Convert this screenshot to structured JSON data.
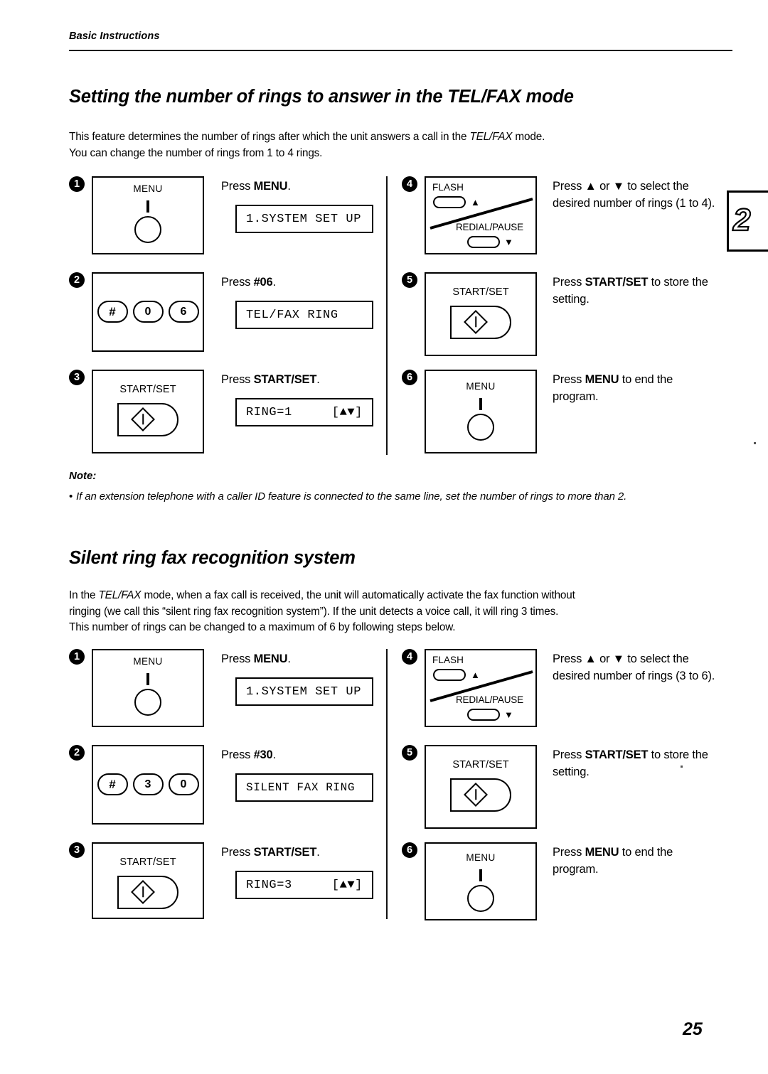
{
  "header": {
    "running_head": "Basic Instructions"
  },
  "page_number": "25",
  "chapter_tab": "2",
  "sections": [
    {
      "title": "Setting the number of rings to answer in the TEL/FAX mode",
      "intro_line1_pre": "This feature determines the number of rings after which the unit answers a call in the ",
      "intro_line1_italic": "TEL/FAX",
      "intro_line1_post": " mode.",
      "intro_line2": "You can change the number of rings from 1 to 4 rings.",
      "steps": [
        {
          "num": "1",
          "panel": "menu-key",
          "panel_label": "MENU",
          "instruction_pre": "Press ",
          "instruction_bold": "MENU",
          "instruction_post": ".",
          "lcd_left": "1.SYSTEM SET UP",
          "lcd_right": ""
        },
        {
          "num": "2",
          "panel": "keypad",
          "keys": [
            "#",
            "0",
            "6"
          ],
          "instruction_pre": "Press ",
          "instruction_bold": "#06",
          "instruction_post": ".",
          "lcd_left": "TEL/FAX RING",
          "lcd_right": ""
        },
        {
          "num": "3",
          "panel": "start-set",
          "panel_label": "START/SET",
          "instruction_pre": "Press ",
          "instruction_bold": "START/SET",
          "instruction_post": ".",
          "lcd_left": "RING=1",
          "lcd_right": "[▲▼]"
        },
        {
          "num": "4",
          "panel": "flash-redial",
          "flash_label": "FLASH",
          "redial_label": "REDIAL/PAUSE",
          "up_arrow": "▲",
          "down_arrow": "▼",
          "instruction_html": "Press ▲ or ▼ to select the desired number of rings (1 to 4).",
          "lcd_left": "",
          "lcd_right": ""
        },
        {
          "num": "5",
          "panel": "start-set",
          "panel_label": "START/SET",
          "instruction_pre": "Press ",
          "instruction_bold": "START/SET",
          "instruction_post": " to store the setting.",
          "lcd_left": "",
          "lcd_right": ""
        },
        {
          "num": "6",
          "panel": "menu-key",
          "panel_label": "MENU",
          "instruction_pre": "Press ",
          "instruction_bold": "MENU",
          "instruction_post": " to end the program.",
          "lcd_left": "",
          "lcd_right": ""
        }
      ],
      "note": {
        "label": "Note:",
        "bullet": "•",
        "text": "If an extension telephone with a caller ID feature is connected to the same line, set the number of rings to more than 2."
      }
    },
    {
      "title": "Silent ring fax recognition system",
      "intro_line1_pre": "In the ",
      "intro_line1_italic": "TEL/FAX",
      "intro_line1_post": " mode, when a fax call is received, the unit will automatically activate the fax function without",
      "intro_line2": "ringing (we call this “silent ring fax recognition system”). If the unit detects a voice call, it will ring 3 times.",
      "intro_line3": "This number of rings can be changed to a maximum of 6 by following steps below.",
      "steps": [
        {
          "num": "1",
          "panel": "menu-key",
          "panel_label": "MENU",
          "instruction_pre": "Press ",
          "instruction_bold": "MENU",
          "instruction_post": ".",
          "lcd_left": "1.SYSTEM SET UP",
          "lcd_right": ""
        },
        {
          "num": "2",
          "panel": "keypad",
          "keys": [
            "#",
            "3",
            "0"
          ],
          "instruction_pre": "Press ",
          "instruction_bold": "#30",
          "instruction_post": ".",
          "lcd_left": "SILENT FAX RING",
          "lcd_right": ""
        },
        {
          "num": "3",
          "panel": "start-set",
          "panel_label": "START/SET",
          "instruction_pre": "Press ",
          "instruction_bold": "START/SET",
          "instruction_post": ".",
          "lcd_left": "RING=3",
          "lcd_right": "[▲▼]"
        },
        {
          "num": "4",
          "panel": "flash-redial",
          "flash_label": "FLASH",
          "redial_label": "REDIAL/PAUSE",
          "up_arrow": "▲",
          "down_arrow": "▼",
          "instruction_html": "Press ▲ or ▼ to select the desired number of rings (3 to 6).",
          "lcd_left": "",
          "lcd_right": ""
        },
        {
          "num": "5",
          "panel": "start-set",
          "panel_label": "START/SET",
          "instruction_pre": "Press ",
          "instruction_bold": "START/SET",
          "instruction_post": " to store the setting.",
          "lcd_left": "",
          "lcd_right": ""
        },
        {
          "num": "6",
          "panel": "menu-key",
          "panel_label": "MENU",
          "instruction_pre": "Press ",
          "instruction_bold": "MENU",
          "instruction_post": " to end the program.",
          "lcd_left": "",
          "lcd_right": ""
        }
      ]
    }
  ]
}
